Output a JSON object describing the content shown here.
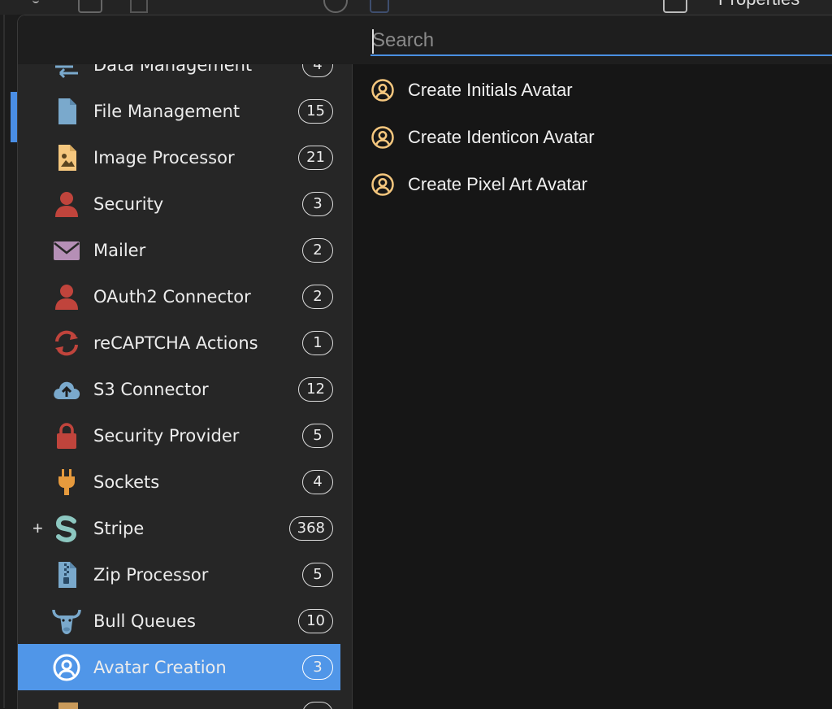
{
  "toolbar": {
    "properties_label": "Properties"
  },
  "search": {
    "placeholder": "Search",
    "value": ""
  },
  "categories": [
    {
      "label": "Data Management",
      "count": "4",
      "icon": "data-management-icon"
    },
    {
      "label": "File Management",
      "count": "15",
      "icon": "file-icon"
    },
    {
      "label": "Image Processor",
      "count": "21",
      "icon": "image-file-icon"
    },
    {
      "label": "Security",
      "count": "3",
      "icon": "user-icon"
    },
    {
      "label": "Mailer",
      "count": "2",
      "icon": "envelope-icon"
    },
    {
      "label": "OAuth2 Connector",
      "count": "2",
      "icon": "user-icon"
    },
    {
      "label": "reCAPTCHA Actions",
      "count": "1",
      "icon": "refresh-icon"
    },
    {
      "label": "S3 Connector",
      "count": "12",
      "icon": "cloud-upload-icon"
    },
    {
      "label": "Security Provider",
      "count": "5",
      "icon": "lock-icon"
    },
    {
      "label": "Sockets",
      "count": "4",
      "icon": "plug-icon"
    },
    {
      "label": "Stripe",
      "count": "368",
      "icon": "stripe-icon",
      "expand": "+"
    },
    {
      "label": "Zip Processor",
      "count": "5",
      "icon": "zip-file-icon"
    },
    {
      "label": "Bull Queues",
      "count": "10",
      "icon": "bull-icon"
    },
    {
      "label": "Avatar Creation",
      "count": "3",
      "icon": "user-circle-icon",
      "selected": true
    }
  ],
  "actions": [
    {
      "label": "Create Initials Avatar",
      "icon": "user-circle-icon"
    },
    {
      "label": "Create Identicon Avatar",
      "icon": "user-circle-icon"
    },
    {
      "label": "Create Pixel Art Avatar",
      "icon": "user-circle-icon"
    }
  ],
  "colors": {
    "selection": "#5096e8",
    "search_underline": "#4a90e2",
    "action_icon": "#f5c77e",
    "file_icon": "#7aa9cc",
    "image_icon": "#f5c77e",
    "security_icon": "#c0443c",
    "mailer_icon": "#b58fb6",
    "sockets_icon": "#e69a3d",
    "stripe_icon": "#8cc7c0"
  }
}
